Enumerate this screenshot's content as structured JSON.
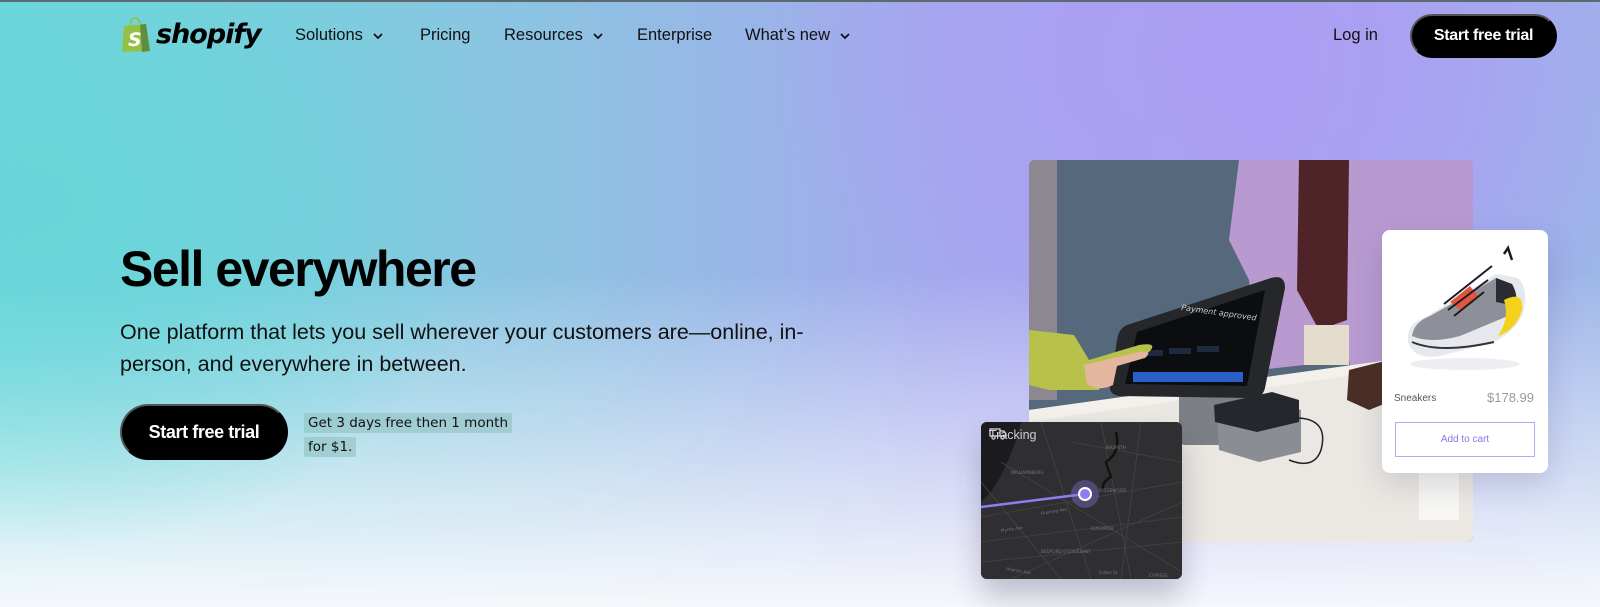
{
  "brand": {
    "name": "shopify",
    "logo_color": "#95bf47"
  },
  "nav": {
    "items": [
      {
        "label": "Solutions",
        "has_dropdown": true
      },
      {
        "label": "Pricing",
        "has_dropdown": false
      },
      {
        "label": "Resources",
        "has_dropdown": true
      },
      {
        "label": "Enterprise",
        "has_dropdown": false
      },
      {
        "label": "What’s new",
        "has_dropdown": true
      }
    ],
    "login_label": "Log in",
    "cta_label": "Start free trial"
  },
  "hero": {
    "title": "Sell everywhere",
    "subtitle": "One platform that lets you sell wherever your customers are—online, in-person, and everywhere in between.",
    "cta_label": "Start free trial",
    "promo_line1": "Get 3 days free then 1 month",
    "promo_line2": "for $1."
  },
  "product_card": {
    "name": "Sneakers",
    "price": "$178.99",
    "button_label": "Add to cart",
    "accent": "#8a78e6"
  },
  "tracking_card": {
    "title": "Tracking",
    "map_labels": [
      "MASPETH",
      "WILLIAMSBURG",
      "RIDGEWOOD",
      "Flushing Ave",
      "Myrtle Ave",
      "BUSHWICK",
      "BEDFORD-STUYVESANT",
      "Fulton St",
      "CYPRESS",
      "Atlantic Ave"
    ],
    "route_color": "#8f7cf0"
  },
  "pos_screen": {
    "status_text": "Payment approved"
  }
}
